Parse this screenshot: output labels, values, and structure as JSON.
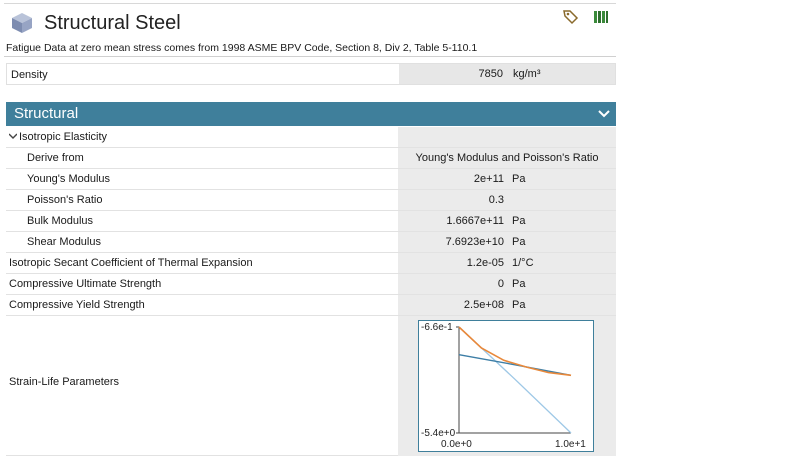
{
  "header": {
    "title": "Structural Steel",
    "description": "Fatigue Data at zero mean stress comes from 1998 ASME BPV Code, Section 8, Div 2, Table 5-110.1",
    "icons": [
      "tag-icon",
      "library-icon"
    ]
  },
  "density": {
    "label": "Density",
    "value": "7850",
    "unit": "kg/m³"
  },
  "structural": {
    "title": "Structural",
    "rows": [
      {
        "label": "Isotropic Elasticity",
        "value": "",
        "unit": "",
        "indent": 0,
        "expanded": true
      },
      {
        "label": "Derive from",
        "value": "Young's Modulus and Poisson's Ratio",
        "unit": "",
        "indent": 1
      },
      {
        "label": "Young's Modulus",
        "value": "2e+11",
        "unit": "Pa",
        "indent": 1
      },
      {
        "label": "Poisson's Ratio",
        "value": "0.3",
        "unit": "",
        "indent": 1
      },
      {
        "label": "Bulk Modulus",
        "value": "1.6667e+11",
        "unit": "Pa",
        "indent": 1
      },
      {
        "label": "Shear Modulus",
        "value": "7.6923e+10",
        "unit": "Pa",
        "indent": 1
      },
      {
        "label": "Isotropic Secant Coefficient of Thermal Expansion",
        "value": "1.2e-05",
        "unit": "1/°C",
        "indent": 0
      },
      {
        "label": "Compressive Ultimate Strength",
        "value": "0",
        "unit": "Pa",
        "indent": 0
      },
      {
        "label": "Compressive Yield Strength",
        "value": "2.5e+08",
        "unit": "Pa",
        "indent": 0
      }
    ],
    "strain_life": {
      "label": "Strain-Life Parameters"
    }
  },
  "chart_data": {
    "type": "line",
    "title": "",
    "xlabel": "",
    "ylabel": "",
    "xlim": [
      0,
      10
    ],
    "ylim": [
      -5.4,
      -0.66
    ],
    "x_tick_labels": [
      "0.0e+0",
      "1.0e+1"
    ],
    "y_tick_labels": [
      "-6.6e-1",
      "-5.4e+0"
    ],
    "series": [
      {
        "color": "#e8883a",
        "x": [
          0,
          2,
          4,
          6,
          8,
          10
        ],
        "y": [
          -0.66,
          -1.6,
          -2.15,
          -2.45,
          -2.7,
          -2.82
        ]
      },
      {
        "color": "#3d7ea6",
        "x": [
          0,
          5,
          10
        ],
        "y": [
          -1.9,
          -2.35,
          -2.82
        ]
      },
      {
        "color": "#9ec8e6",
        "x": [
          0,
          5,
          10
        ],
        "y": [
          -0.66,
          -3.0,
          -5.4
        ]
      }
    ],
    "grid": false,
    "colors": {
      "accent": "#3f7f9b"
    }
  }
}
